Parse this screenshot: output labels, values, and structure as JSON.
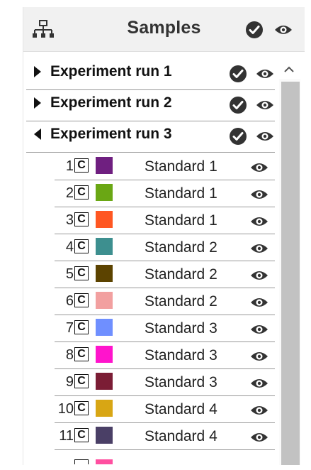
{
  "header": {
    "title": "Samples",
    "hierarchy_icon": "hierarchy-icon",
    "check_icon": "check-circle-icon",
    "eye_icon": "eye-icon"
  },
  "groups": [
    {
      "label": "Experiment run 1",
      "expanded": false
    },
    {
      "label": "Experiment run 2",
      "expanded": false
    },
    {
      "label": "Experiment run 3",
      "expanded": true
    }
  ],
  "samples": [
    {
      "index": "1",
      "type": "C",
      "color": "#6f1f80",
      "name": "Standard 1"
    },
    {
      "index": "2",
      "type": "C",
      "color": "#6aa714",
      "name": "Standard 1"
    },
    {
      "index": "3",
      "type": "C",
      "color": "#ff5722",
      "name": "Standard 1"
    },
    {
      "index": "4",
      "type": "C",
      "color": "#3d8f8f",
      "name": "Standard 2"
    },
    {
      "index": "5",
      "type": "C",
      "color": "#5c4300",
      "name": "Standard 2"
    },
    {
      "index": "6",
      "type": "C",
      "color": "#f2a0a0",
      "name": "Standard 2"
    },
    {
      "index": "7",
      "type": "C",
      "color": "#6f8fff",
      "name": "Standard 3"
    },
    {
      "index": "8",
      "type": "C",
      "color": "#ff14cc",
      "name": "Standard 3"
    },
    {
      "index": "9",
      "type": "C",
      "color": "#7b1d35",
      "name": "Standard 3"
    },
    {
      "index": "10",
      "type": "C",
      "color": "#d8a614",
      "name": "Standard 4"
    },
    {
      "index": "11",
      "type": "C",
      "color": "#4a3f66",
      "name": "Standard 4"
    },
    {
      "index": "",
      "type": "",
      "color": "#ff4fa0",
      "name": ""
    }
  ],
  "scrollbar": {
    "up_icon": "chevron-up-icon"
  }
}
